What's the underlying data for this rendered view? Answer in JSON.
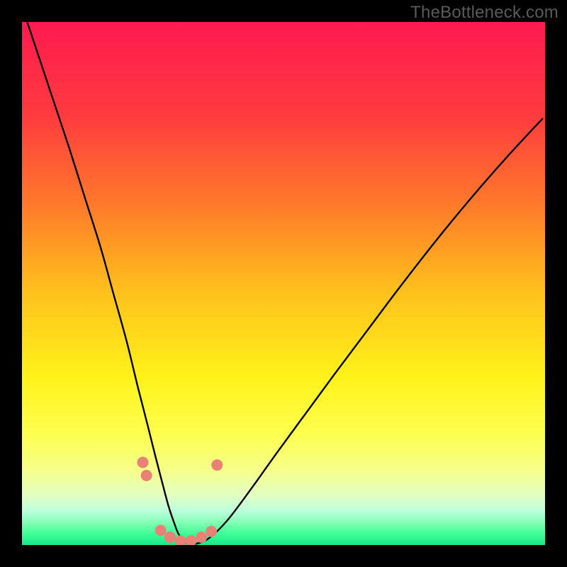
{
  "watermark": "TheBottleneck.com",
  "plot": {
    "dimensions": {
      "outer_w": 800,
      "outer_h": 800,
      "inner_x": 31,
      "inner_y": 31,
      "inner_w": 738,
      "inner_h": 738
    },
    "gradient": {
      "stops": [
        {
          "offset": 0.0,
          "color": "#ff1a4f"
        },
        {
          "offset": 0.18,
          "color": "#ff3b3f"
        },
        {
          "offset": 0.35,
          "color": "#ff7a2a"
        },
        {
          "offset": 0.52,
          "color": "#ffc21c"
        },
        {
          "offset": 0.68,
          "color": "#fff21a"
        },
        {
          "offset": 0.79,
          "color": "#fdff50"
        },
        {
          "offset": 0.86,
          "color": "#f6ff8d"
        },
        {
          "offset": 0.905,
          "color": "#e2ffc3"
        },
        {
          "offset": 0.935,
          "color": "#bcffdd"
        },
        {
          "offset": 0.958,
          "color": "#80ffb3"
        },
        {
          "offset": 0.978,
          "color": "#3fff97"
        },
        {
          "offset": 1.0,
          "color": "#16e889"
        }
      ]
    },
    "marker_color": "#e88277",
    "marker_radius": 8,
    "curve_stroke": "#000000",
    "curve_width": 2.4
  },
  "chart_data": {
    "type": "line",
    "title": "",
    "xlabel": "",
    "ylabel": "",
    "xlim": [
      0,
      1
    ],
    "ylim": [
      0,
      1
    ],
    "note": "Axes are unlabeled in the source image; x/y expressed as fractions of the plot box (0,0 = top-left).",
    "series": [
      {
        "name": "V-curve",
        "x": [
          0.01,
          0.03,
          0.06,
          0.09,
          0.12,
          0.15,
          0.175,
          0.2,
          0.222,
          0.24,
          0.255,
          0.268,
          0.28,
          0.29,
          0.3,
          0.315,
          0.335,
          0.36,
          0.395,
          0.44,
          0.49,
          0.545,
          0.6,
          0.66,
          0.72,
          0.79,
          0.86,
          0.93,
          0.995
        ],
        "y": [
          0.0,
          0.06,
          0.15,
          0.24,
          0.335,
          0.43,
          0.52,
          0.61,
          0.7,
          0.77,
          0.83,
          0.88,
          0.925,
          0.955,
          0.98,
          0.997,
          0.997,
          0.985,
          0.95,
          0.89,
          0.82,
          0.745,
          0.67,
          0.59,
          0.51,
          0.42,
          0.335,
          0.255,
          0.185
        ]
      }
    ],
    "markers": [
      {
        "x": 0.231,
        "y": 0.842
      },
      {
        "x": 0.238,
        "y": 0.867
      },
      {
        "x": 0.265,
        "y": 0.972
      },
      {
        "x": 0.283,
        "y": 0.985
      },
      {
        "x": 0.303,
        "y": 0.992
      },
      {
        "x": 0.323,
        "y": 0.992
      },
      {
        "x": 0.343,
        "y": 0.985
      },
      {
        "x": 0.362,
        "y": 0.974
      },
      {
        "x": 0.373,
        "y": 0.847
      }
    ]
  }
}
